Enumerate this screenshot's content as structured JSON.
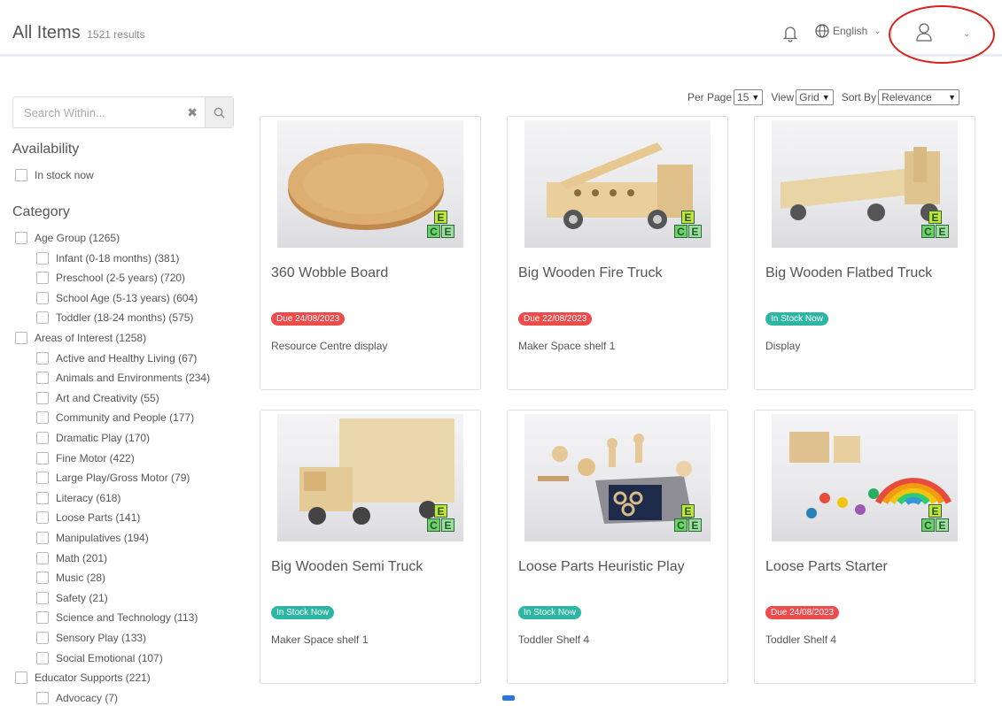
{
  "header": {
    "title": "All Items",
    "result_count": "1521 results",
    "language": "English"
  },
  "search": {
    "placeholder": "Search Within..."
  },
  "availability": {
    "title": "Availability",
    "options": [
      "In stock now"
    ]
  },
  "category": {
    "title": "Category",
    "items": [
      {
        "label": "Age Group (1265)",
        "level": 0
      },
      {
        "label": "Infant (0-18 months) (381)",
        "level": 1
      },
      {
        "label": "Preschool (2-5 years) (720)",
        "level": 1
      },
      {
        "label": "School Age (5-13 years) (604)",
        "level": 1
      },
      {
        "label": "Toddler (18-24 months) (575)",
        "level": 1
      },
      {
        "label": "Areas of Interest (1258)",
        "level": 0
      },
      {
        "label": "Active and Healthy Living (67)",
        "level": 1
      },
      {
        "label": "Animals and Environments (234)",
        "level": 1
      },
      {
        "label": "Art and Creativity (55)",
        "level": 1
      },
      {
        "label": "Community and People (177)",
        "level": 1
      },
      {
        "label": "Dramatic Play (170)",
        "level": 1
      },
      {
        "label": "Fine Motor (422)",
        "level": 1
      },
      {
        "label": "Large Play/Gross Motor (79)",
        "level": 1
      },
      {
        "label": "Literacy (618)",
        "level": 1
      },
      {
        "label": "Loose Parts (141)",
        "level": 1
      },
      {
        "label": "Manipulatives (194)",
        "level": 1
      },
      {
        "label": "Math (201)",
        "level": 1
      },
      {
        "label": "Music (28)",
        "level": 1
      },
      {
        "label": "Safety (21)",
        "level": 1
      },
      {
        "label": "Science and Technology (113)",
        "level": 1
      },
      {
        "label": "Sensory Play (133)",
        "level": 1
      },
      {
        "label": "Social Emotional (107)",
        "level": 1
      },
      {
        "label": "Educator Supports (221)",
        "level": 0
      },
      {
        "label": "Advocacy (7)",
        "level": 1
      }
    ]
  },
  "toolbar": {
    "per_page_label": "Per Page",
    "per_page_value": "15",
    "view_label": "View",
    "view_value": "Grid",
    "sort_label": "Sort By",
    "sort_value": "Relevance"
  },
  "items": [
    {
      "name": "360 Wobble Board",
      "status": "Due 24/08/2023",
      "status_type": "due",
      "location": "Resource Centre display"
    },
    {
      "name": "Big Wooden Fire Truck",
      "status": "Due 22/08/2023",
      "status_type": "due",
      "location": "Maker Space shelf 1"
    },
    {
      "name": "Big Wooden Flatbed Truck",
      "status": "In Stock Now",
      "status_type": "stock",
      "location": "Display"
    },
    {
      "name": "Big Wooden Semi Truck",
      "status": "In Stock Now",
      "status_type": "stock",
      "location": "Maker Space shelf 1"
    },
    {
      "name": "Loose Parts Heuristic Play",
      "status": "In Stock Now",
      "status_type": "stock",
      "location": "Toddler Shelf 4"
    },
    {
      "name": "Loose Parts Starter",
      "status": "Due 24/08/2023",
      "status_type": "due",
      "location": "Toddler Shelf 4"
    }
  ],
  "logo_letters": [
    "E",
    "C",
    "E"
  ],
  "colors": {
    "due": "#ef4b4b",
    "in_stock": "#2db6a3",
    "annotation_circle": "#d9231f"
  }
}
